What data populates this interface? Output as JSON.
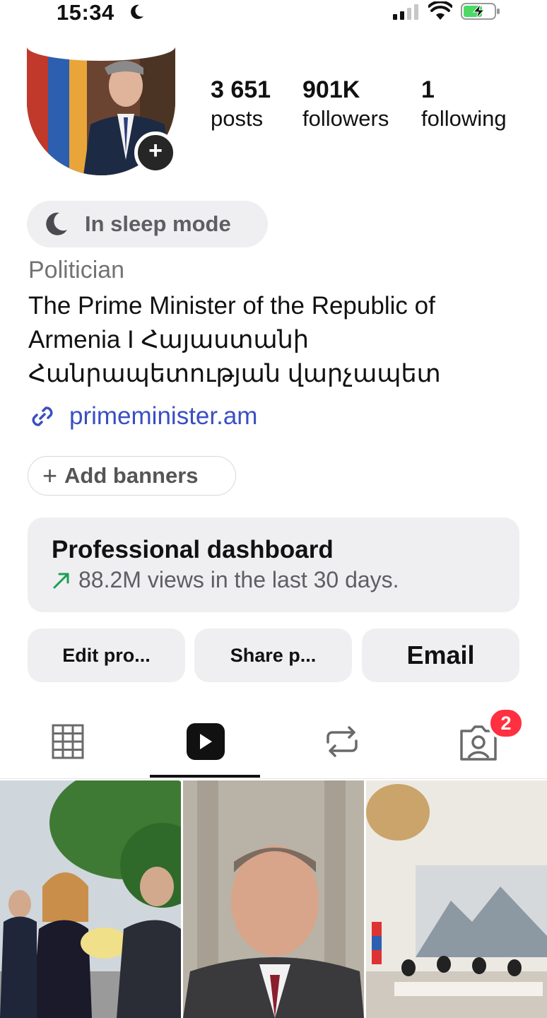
{
  "status_bar": {
    "time": "15:34"
  },
  "profile": {
    "stats": [
      {
        "value": "3 651",
        "label": "posts"
      },
      {
        "value": "901K",
        "label": "followers"
      },
      {
        "value": "1",
        "label": "following"
      }
    ],
    "sleep_status": "In sleep mode",
    "category": "Politician",
    "bio_line_1": "The Prime Minister of the Republic of",
    "bio_line_2": "Armenia I Հայաստանի",
    "bio_line_3": "Հանրապետության վարչապետ",
    "link": "primeminister.am"
  },
  "banners": {
    "label": "Add banners"
  },
  "dashboard": {
    "title": "Professional dashboard",
    "subtitle": "88.2M views in the last 30 days."
  },
  "buttons": {
    "edit": "Edit pro...",
    "share": "Share p...",
    "email": "Email"
  },
  "tabs": {
    "active": "reels",
    "tagged_badge": "2"
  },
  "colors": {
    "link": "#3a4fc2",
    "badge": "#ff3040",
    "pill_bg": "#efeff1"
  },
  "icons": [
    "moon-icon",
    "signal-icon",
    "wifi-icon",
    "battery-charging-icon",
    "plus-icon",
    "link-icon",
    "trend-arrow-icon",
    "grid-icon",
    "reels-icon",
    "repost-icon",
    "tagged-icon"
  ]
}
